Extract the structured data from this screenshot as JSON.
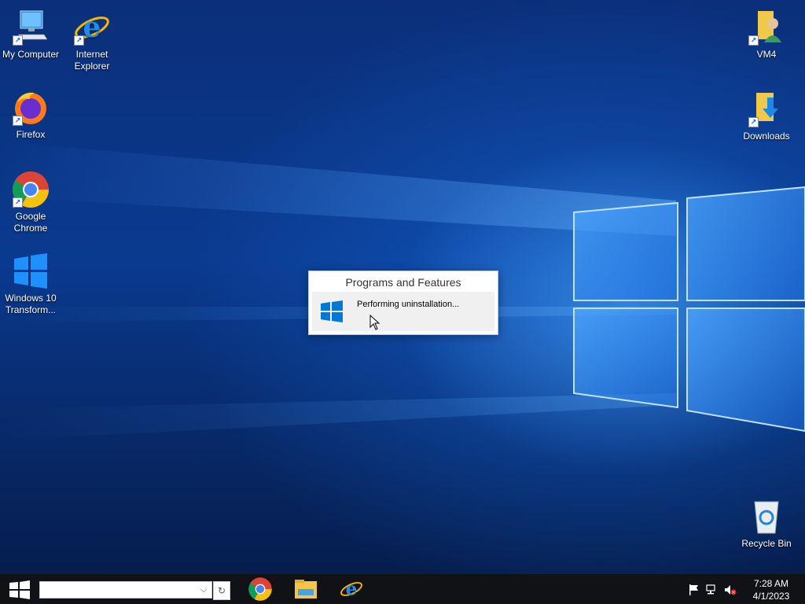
{
  "desktop_icons": {
    "my_computer": "My Computer",
    "internet_explorer": "Internet Explorer",
    "firefox": "Firefox",
    "chrome": "Google Chrome",
    "win10": "Windows 10 Transform...",
    "vm4": "VM4",
    "downloads": "Downloads",
    "recycle_bin": "Recycle Bin"
  },
  "dialog": {
    "title": "Programs and Features",
    "status": "Performing uninstallation..."
  },
  "taskbar": {
    "search_value": "",
    "apps": [
      "chrome-icon",
      "file-explorer-icon",
      "internet-explorer-icon"
    ],
    "tray_icons": [
      "flag-icon",
      "network-icon",
      "volume-muted-icon"
    ],
    "time": "7:28 AM",
    "date": "4/1/2023"
  },
  "colors": {
    "taskbar": "#101216",
    "accent": "#0078d7",
    "dialog_bg": "#ffffff"
  }
}
